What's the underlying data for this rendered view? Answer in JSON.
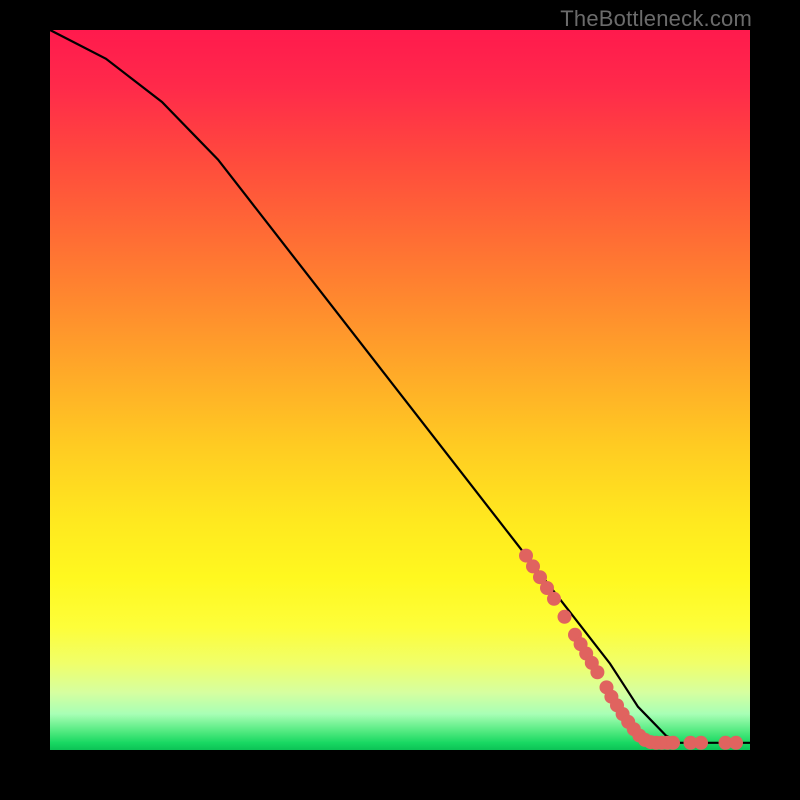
{
  "watermark": "TheBottleneck.com",
  "chart_data": {
    "type": "line",
    "title": "",
    "xlabel": "",
    "ylabel": "",
    "xlim": [
      0,
      100
    ],
    "ylim": [
      0,
      100
    ],
    "grid": false,
    "legend": false,
    "series": [
      {
        "name": "curve",
        "color": "#000000",
        "x": [
          0,
          4,
          8,
          12,
          16,
          20,
          24,
          28,
          32,
          36,
          40,
          44,
          48,
          52,
          56,
          60,
          64,
          68,
          72,
          76,
          80,
          82,
          84,
          86,
          88,
          90,
          92,
          94,
          96,
          98,
          100
        ],
        "y": [
          100,
          98,
          96,
          93,
          90,
          86,
          82,
          77,
          72,
          67,
          62,
          57,
          52,
          47,
          42,
          37,
          32,
          27,
          22,
          17,
          12,
          9,
          6,
          4,
          2,
          1,
          1,
          1,
          1,
          1,
          1
        ]
      }
    ],
    "markers": [
      {
        "name": "highlight-dots",
        "color": "#e0635f",
        "radius_px": 7,
        "points": [
          {
            "x": 68,
            "y": 27
          },
          {
            "x": 69,
            "y": 25.5
          },
          {
            "x": 70,
            "y": 24
          },
          {
            "x": 71,
            "y": 22.5
          },
          {
            "x": 72,
            "y": 21
          },
          {
            "x": 73.5,
            "y": 18.5
          },
          {
            "x": 75,
            "y": 16
          },
          {
            "x": 75.8,
            "y": 14.7
          },
          {
            "x": 76.6,
            "y": 13.4
          },
          {
            "x": 77.4,
            "y": 12.1
          },
          {
            "x": 78.2,
            "y": 10.8
          },
          {
            "x": 79.5,
            "y": 8.7
          },
          {
            "x": 80.2,
            "y": 7.4
          },
          {
            "x": 81.0,
            "y": 6.2
          },
          {
            "x": 81.8,
            "y": 5.0
          },
          {
            "x": 82.6,
            "y": 3.9
          },
          {
            "x": 83.4,
            "y": 2.9
          },
          {
            "x": 84.2,
            "y": 2.0
          },
          {
            "x": 85.0,
            "y": 1.4
          },
          {
            "x": 85.8,
            "y": 1.1
          },
          {
            "x": 86.6,
            "y": 1.0
          },
          {
            "x": 87.4,
            "y": 1.0
          },
          {
            "x": 88.2,
            "y": 1.0
          },
          {
            "x": 89.0,
            "y": 1.0
          },
          {
            "x": 91.5,
            "y": 1.0
          },
          {
            "x": 93.0,
            "y": 1.0
          },
          {
            "x": 96.5,
            "y": 1.0
          },
          {
            "x": 98.0,
            "y": 1.0
          }
        ]
      }
    ]
  }
}
